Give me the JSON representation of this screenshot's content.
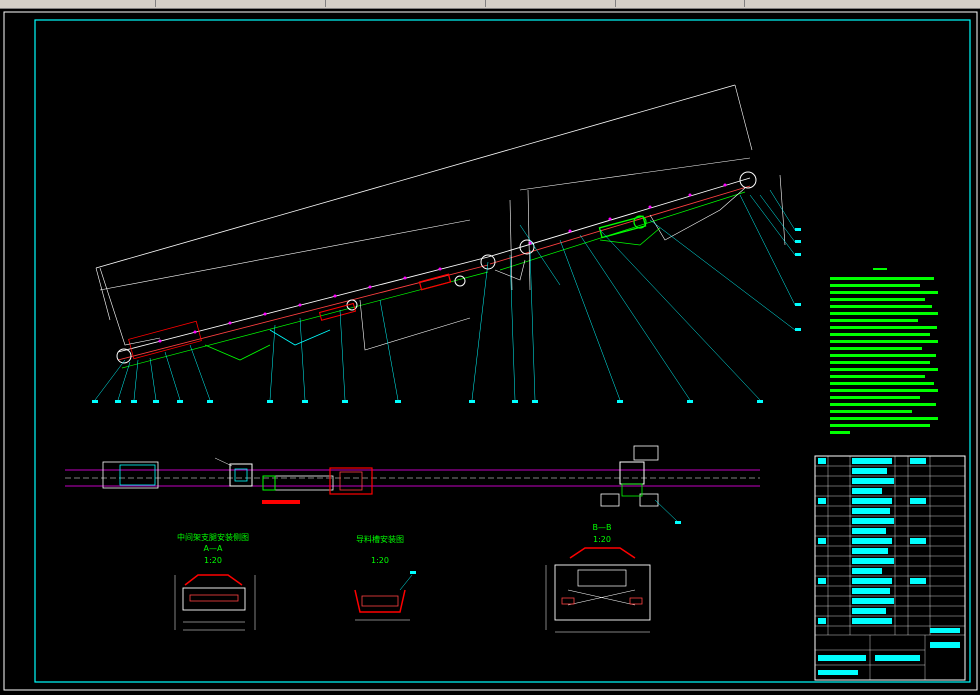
{
  "toolbar": {
    "items": [
      "",
      "",
      "",
      "",
      ""
    ]
  },
  "colors": {
    "background": "#000000",
    "frame": "#00ffff",
    "outline": "#00ff00",
    "belt": "#ff0000",
    "center_line": "#ff00ff",
    "dimension": "#ffffff",
    "notes": "#00ff00",
    "toolbar": "#d4d0c8"
  },
  "views": {
    "section_a": {
      "title": "中间架支腿安装侧图",
      "label": "A—A",
      "scale": "1:20"
    },
    "guide_chute": {
      "title": "导料槽安装图",
      "scale": "1:20"
    },
    "section_b": {
      "label": "B—B",
      "scale": "1:20"
    }
  }
}
